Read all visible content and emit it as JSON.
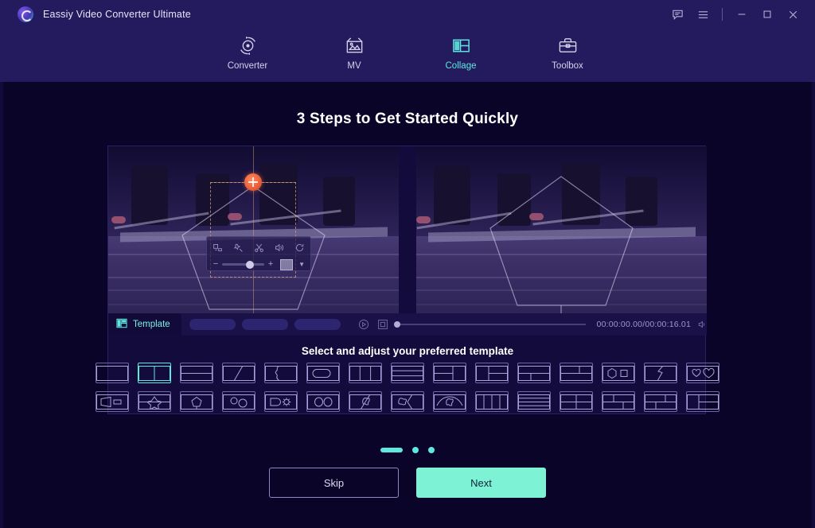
{
  "window": {
    "app_title": "Eassiy Video Converter Ultimate",
    "logo_icon": "eassiy-logo-icon",
    "controls": [
      {
        "name": "feedback-icon",
        "label": "Feedback"
      },
      {
        "name": "menu-icon",
        "label": "Menu"
      },
      {
        "name": "minimize-icon",
        "label": "Minimize"
      },
      {
        "name": "maximize-icon",
        "label": "Maximize"
      },
      {
        "name": "close-icon",
        "label": "Close"
      }
    ]
  },
  "nav": {
    "tabs": [
      {
        "label": "Converter",
        "icon": "converter-icon",
        "active": false
      },
      {
        "label": "MV",
        "icon": "mv-icon",
        "active": false
      },
      {
        "label": "Collage",
        "icon": "collage-icon",
        "active": true
      },
      {
        "label": "Toolbox",
        "icon": "toolbox-icon",
        "active": false
      }
    ]
  },
  "main": {
    "headline": "3 Steps to Get Started Quickly",
    "picker_title": "Select and adjust your preferred template"
  },
  "preview": {
    "float_toolbar": {
      "icons": [
        {
          "name": "edit-crop-icon"
        },
        {
          "name": "effects-magic-icon"
        },
        {
          "name": "trim-scissors-icon"
        },
        {
          "name": "volume-icon"
        },
        {
          "name": "rotate-icon"
        }
      ],
      "minus_label": "−",
      "plus_label": "+",
      "slider_value": 56,
      "swatch_name": "color-swatch-button",
      "caret_name": "chevron-down-icon"
    },
    "overlay": {
      "anchor_name": "crop-anchor-handle",
      "shape": "pentagon"
    }
  },
  "timeline": {
    "tab_label": "Template",
    "tab_icon": "template-grid-icon",
    "pill_count": 3,
    "play_icon": "play-icon",
    "snapshot_icon": "snapshot-icon",
    "progress": 0,
    "time_display": "00:00:00.00/00:00:16.01",
    "volume_icon": "speaker-icon"
  },
  "templates": {
    "selected_index": 1,
    "rows": [
      [
        {
          "name": "tpl-single",
          "shape": "single"
        },
        {
          "name": "tpl-two-vertical",
          "shape": "two-vertical"
        },
        {
          "name": "tpl-two-horizontal",
          "shape": "two-horizontal"
        },
        {
          "name": "tpl-diagonal",
          "shape": "diagonal"
        },
        {
          "name": "tpl-puzzle",
          "shape": "puzzle"
        },
        {
          "name": "tpl-rounded",
          "shape": "rounded"
        },
        {
          "name": "tpl-three-column",
          "shape": "three-column"
        },
        {
          "name": "tpl-three-row",
          "shape": "three-row"
        },
        {
          "name": "tpl-left-split-right",
          "shape": "left-split-right"
        },
        {
          "name": "tpl-right-split-left",
          "shape": "right-split-left"
        },
        {
          "name": "tpl-top-two-bottom",
          "shape": "top-two-bottom"
        },
        {
          "name": "tpl-bottom-two-top",
          "shape": "bottom-two-top"
        },
        {
          "name": "tpl-hexagon-square",
          "shape": "hexagon-square"
        },
        {
          "name": "tpl-lightning",
          "shape": "lightning"
        },
        {
          "name": "tpl-two-hearts",
          "shape": "two-hearts"
        }
      ],
      [
        {
          "name": "tpl-trapezoid",
          "shape": "trapezoid"
        },
        {
          "name": "tpl-star",
          "shape": "star"
        },
        {
          "name": "tpl-pentagon",
          "shape": "pentagon"
        },
        {
          "name": "tpl-two-circles",
          "shape": "two-circles"
        },
        {
          "name": "tpl-gear",
          "shape": "gear"
        },
        {
          "name": "tpl-two-ovals",
          "shape": "two-ovals"
        },
        {
          "name": "tpl-flower-split",
          "shape": "flower-split"
        },
        {
          "name": "tpl-blob-arrow",
          "shape": "blob-arrow"
        },
        {
          "name": "tpl-arch-flower",
          "shape": "arch-flower"
        },
        {
          "name": "tpl-four-column",
          "shape": "four-column"
        },
        {
          "name": "tpl-four-row",
          "shape": "four-row"
        },
        {
          "name": "tpl-quad-grid",
          "shape": "quad-grid"
        },
        {
          "name": "tpl-grid-uneven-a",
          "shape": "grid-uneven-a"
        },
        {
          "name": "tpl-grid-uneven-b",
          "shape": "grid-uneven-b"
        },
        {
          "name": "tpl-grid-uneven-c",
          "shape": "grid-uneven-c"
        }
      ]
    ]
  },
  "pager": {
    "pages": 3,
    "current": 0
  },
  "footer": {
    "skip_label": "Skip",
    "next_label": "Next"
  },
  "colors": {
    "accent": "#5fe8df",
    "next_button": "#7df2d4",
    "titlebar": "#241b5e",
    "background": "#0a0528"
  }
}
